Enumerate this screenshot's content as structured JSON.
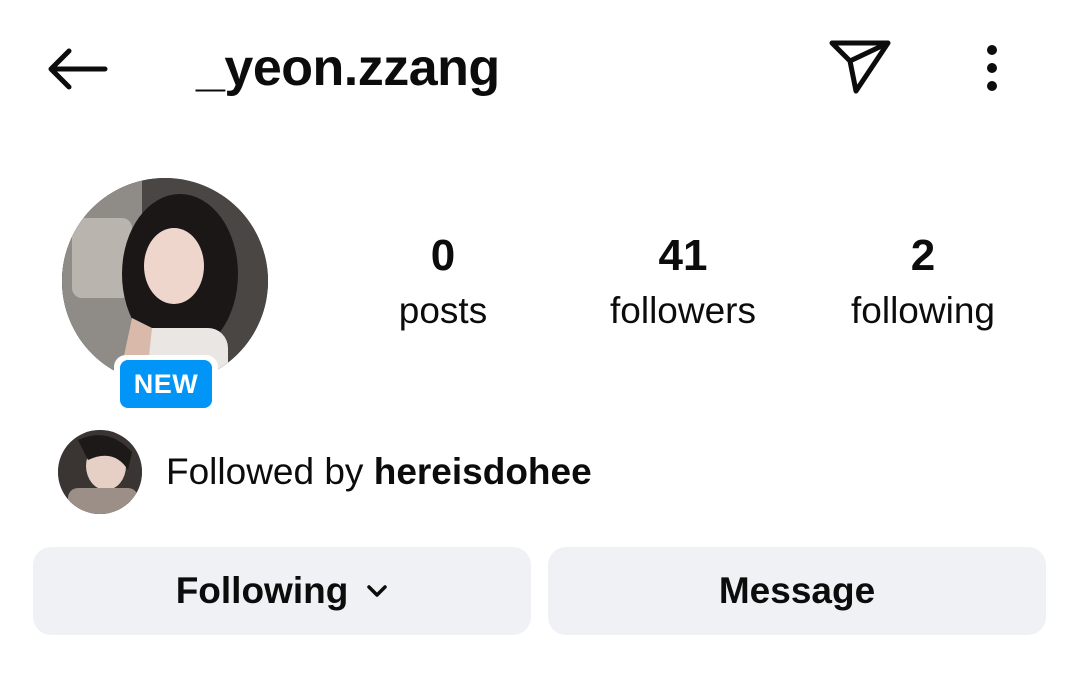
{
  "header": {
    "username": "_yeon.zzang"
  },
  "profile": {
    "badge": "NEW",
    "stats": [
      {
        "value": "0",
        "label": "posts"
      },
      {
        "value": "41",
        "label": "followers"
      },
      {
        "value": "2",
        "label": "following"
      }
    ]
  },
  "followed_by": {
    "prefix": "Followed by ",
    "name": "hereisdohee"
  },
  "actions": {
    "following_label": "Following",
    "message_label": "Message"
  },
  "colors": {
    "badge": "#0095f6",
    "button_bg": "#eff1f4"
  },
  "icons": {
    "back": "arrow-left-icon",
    "send": "paper-plane-icon",
    "more": "more-vertical-icon",
    "dropdown": "chevron-down-icon"
  }
}
